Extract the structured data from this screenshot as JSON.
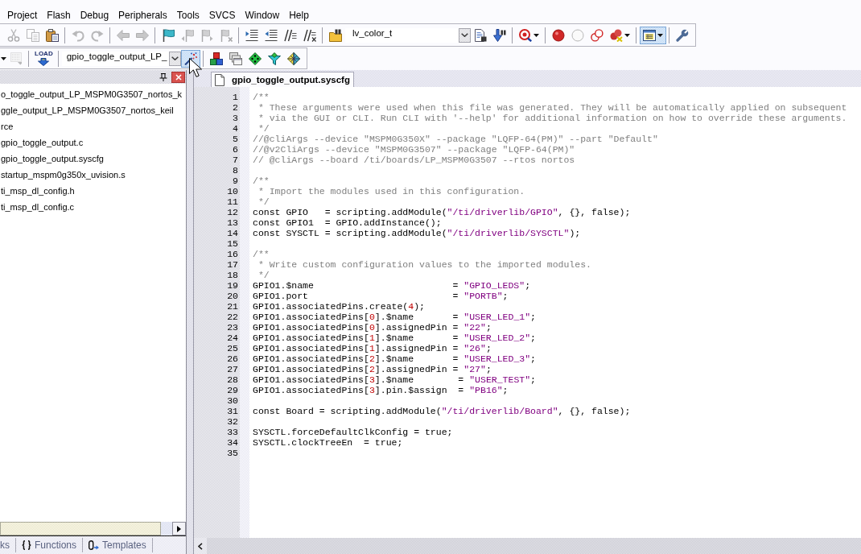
{
  "menu_bar": {
    "items": [
      "Project",
      "Flash",
      "Debug",
      "Peripherals",
      "Tools",
      "SVCS",
      "Window",
      "Help"
    ]
  },
  "toolbars": [
    {
      "groups": [
        {
          "items": [
            {
              "kind": "button",
              "disabled": true,
              "highlighted": false
            },
            {
              "kind": "button",
              "disabled": true,
              "highlighted": false
            },
            {
              "kind": "button",
              "disabled": false,
              "highlighted": false
            }
          ]
        },
        {
          "items": [
            {
              "kind": "button",
              "disabled": true,
              "highlighted": false
            },
            {
              "kind": "button",
              "disabled": true,
              "highlighted": false
            }
          ]
        },
        {
          "items": [
            {
              "kind": "button",
              "disabled": true,
              "highlighted": false
            },
            {
              "kind": "button",
              "disabled": true,
              "highlighted": false
            }
          ]
        },
        {
          "items": [
            {
              "kind": "button",
              "disabled": false,
              "highlighted": false
            },
            {
              "kind": "button",
              "disabled": true,
              "highlighted": false
            },
            {
              "kind": "button",
              "disabled": true,
              "highlighted": false
            },
            {
              "kind": "button",
              "disabled": true,
              "highlighted": false
            }
          ]
        },
        {
          "items": [
            {
              "kind": "button",
              "disabled": false,
              "highlighted": false
            },
            {
              "kind": "button",
              "disabled": false,
              "highlighted": false
            },
            {
              "kind": "button",
              "disabled": false,
              "highlighted": false
            },
            {
              "kind": "button",
              "disabled": false,
              "highlighted": false
            }
          ]
        },
        {
          "items": [
            {
              "kind": "button",
              "disabled": false,
              "highlighted": false
            },
            {
              "kind": "combo",
              "value": "lv_color_t"
            },
            {
              "kind": "button",
              "disabled": false,
              "highlighted": false
            },
            {
              "kind": "button",
              "disabled": false,
              "highlighted": false
            }
          ]
        },
        {
          "items": [
            {
              "kind": "dropdown",
              "disabled": false,
              "highlighted": false
            }
          ]
        },
        {
          "items": [
            {
              "kind": "button",
              "disabled": false,
              "highlighted": false
            },
            {
              "kind": "button",
              "disabled": false,
              "highlighted": false
            },
            {
              "kind": "button",
              "disabled": false,
              "highlighted": false
            },
            {
              "kind": "dropdown",
              "disabled": false,
              "highlighted": false
            }
          ]
        },
        {
          "items": [
            {
              "kind": "dropdown",
              "disabled": false,
              "highlighted": true
            }
          ]
        },
        {
          "items": [
            {
              "kind": "button",
              "disabled": false,
              "highlighted": false
            }
          ]
        }
      ]
    },
    {
      "groups": [
        {
          "items": [
            {
              "kind": "caret"
            },
            {
              "kind": "button",
              "disabled": true,
              "highlighted": false
            }
          ]
        },
        {
          "items": [
            {
              "kind": "button",
              "label": "LOAD",
              "disabled": false,
              "highlighted": false
            }
          ]
        },
        {
          "items": [
            {
              "kind": "combo",
              "value": "gpio_toggle_output_LP_"
            },
            {
              "kind": "button",
              "disabled": false,
              "highlighted": true
            }
          ]
        },
        {
          "items": [
            {
              "kind": "button",
              "disabled": false,
              "highlighted": false
            },
            {
              "kind": "button",
              "disabled": false,
              "highlighted": false
            },
            {
              "kind": "button",
              "disabled": false,
              "highlighted": false
            },
            {
              "kind": "button",
              "disabled": false,
              "highlighted": false
            },
            {
              "kind": "button",
              "disabled": false,
              "highlighted": false
            }
          ]
        }
      ]
    }
  ],
  "project_panel": {
    "items": [
      "o_toggle_output_LP_MSPM0G3507_nortos_k",
      "ggle_output_LP_MSPM0G3507_nortos_keil",
      "rce",
      "gpio_toggle_output.c",
      "gpio_toggle_output.syscfg",
      "startup_mspm0g350x_uvision.s",
      "ti_msp_dl_config.h",
      "ti_msp_dl_config.c"
    ],
    "tabs": [
      {
        "label": "ks",
        "selected": false
      },
      {
        "label": "Functions",
        "selected": false
      },
      {
        "label": "Templates",
        "selected": false
      }
    ]
  },
  "editor": {
    "tabs": [
      {
        "label": "gpio_toggle_output.syscfg",
        "selected": true
      }
    ],
    "lines": [
      {
        "number": "1",
        "tokens": [
          {
            "kind": "comment",
            "text": "/**"
          }
        ]
      },
      {
        "number": "2",
        "tokens": [
          {
            "kind": "comment",
            "text": " * These arguments were used when this file was generated. They will be automatically applied on subsequent"
          }
        ]
      },
      {
        "number": "3",
        "tokens": [
          {
            "kind": "comment",
            "text": " * via the GUI or CLI. Run CLI with '--help' for additional information on how to override these arguments."
          }
        ]
      },
      {
        "number": "4",
        "tokens": [
          {
            "kind": "comment",
            "text": " */"
          }
        ]
      },
      {
        "number": "5",
        "tokens": [
          {
            "kind": "comment",
            "text": "//@cliArgs --device \"MSPM0G350X\" --package \"LQFP-64(PM)\" --part \"Default\""
          }
        ]
      },
      {
        "number": "6",
        "tokens": [
          {
            "kind": "comment",
            "text": "//@v2CliArgs --device \"MSPM0G3507\" --package \"LQFP-64(PM)\""
          }
        ]
      },
      {
        "number": "7",
        "tokens": [
          {
            "kind": "comment",
            "text": "// @cliArgs --board /ti/boards/LP_MSPM0G3507 --rtos nortos"
          }
        ]
      },
      {
        "number": "8"
      },
      {
        "number": "9",
        "tokens": [
          {
            "kind": "comment",
            "text": "/**"
          }
        ]
      },
      {
        "number": "10",
        "tokens": [
          {
            "kind": "comment",
            "text": " * Import the modules used in this configuration."
          }
        ]
      },
      {
        "number": "11",
        "tokens": [
          {
            "kind": "comment",
            "text": " */"
          }
        ]
      },
      {
        "number": "12",
        "tokens": [
          {
            "kind": "text",
            "text": "const GPIO   = scripting.addModule("
          },
          {
            "kind": "string",
            "text": "\"/ti/driverlib/GPIO\""
          },
          {
            "kind": "text",
            "text": ", {}, false);"
          }
        ]
      },
      {
        "number": "13",
        "tokens": [
          {
            "kind": "text",
            "text": "const GPIO1  = GPIO.addInstance();"
          }
        ]
      },
      {
        "number": "14",
        "tokens": [
          {
            "kind": "text",
            "text": "const SYSCTL = scripting.addModule("
          },
          {
            "kind": "string",
            "text": "\"/ti/driverlib/SYSCTL\""
          },
          {
            "kind": "text",
            "text": ");"
          }
        ]
      },
      {
        "number": "15"
      },
      {
        "number": "16",
        "tokens": [
          {
            "kind": "comment",
            "text": "/**"
          }
        ]
      },
      {
        "number": "17",
        "tokens": [
          {
            "kind": "comment",
            "text": " * Write custom configuration values to the imported modules."
          }
        ]
      },
      {
        "number": "18",
        "tokens": [
          {
            "kind": "comment",
            "text": " */"
          }
        ]
      },
      {
        "number": "19",
        "tokens": [
          {
            "kind": "text",
            "text": "GPIO1.$name                         = "
          },
          {
            "kind": "string",
            "text": "\"GPIO_LEDS\""
          },
          {
            "kind": "text",
            "text": ";"
          }
        ]
      },
      {
        "number": "20",
        "tokens": [
          {
            "kind": "text",
            "text": "GPIO1.port                          = "
          },
          {
            "kind": "string",
            "text": "\"PORTB\""
          },
          {
            "kind": "text",
            "text": ";"
          }
        ]
      },
      {
        "number": "21",
        "tokens": [
          {
            "kind": "text",
            "text": "GPIO1.associatedPins.create("
          },
          {
            "kind": "number",
            "text": "4"
          },
          {
            "kind": "text",
            "text": ");"
          }
        ]
      },
      {
        "number": "22",
        "tokens": [
          {
            "kind": "text",
            "text": "GPIO1.associatedPins["
          },
          {
            "kind": "number",
            "text": "0"
          },
          {
            "kind": "text",
            "text": "].$name       = "
          },
          {
            "kind": "string",
            "text": "\"USER_LED_1\""
          },
          {
            "kind": "text",
            "text": ";"
          }
        ]
      },
      {
        "number": "23",
        "tokens": [
          {
            "kind": "text",
            "text": "GPIO1.associatedPins["
          },
          {
            "kind": "number",
            "text": "0"
          },
          {
            "kind": "text",
            "text": "].assignedPin = "
          },
          {
            "kind": "string",
            "text": "\"22\""
          },
          {
            "kind": "text",
            "text": ";"
          }
        ]
      },
      {
        "number": "24",
        "tokens": [
          {
            "kind": "text",
            "text": "GPIO1.associatedPins["
          },
          {
            "kind": "number",
            "text": "1"
          },
          {
            "kind": "text",
            "text": "].$name       = "
          },
          {
            "kind": "string",
            "text": "\"USER_LED_2\""
          },
          {
            "kind": "text",
            "text": ";"
          }
        ]
      },
      {
        "number": "25",
        "tokens": [
          {
            "kind": "text",
            "text": "GPIO1.associatedPins["
          },
          {
            "kind": "number",
            "text": "1"
          },
          {
            "kind": "text",
            "text": "].assignedPin = "
          },
          {
            "kind": "string",
            "text": "\"26\""
          },
          {
            "kind": "text",
            "text": ";"
          }
        ]
      },
      {
        "number": "26",
        "tokens": [
          {
            "kind": "text",
            "text": "GPIO1.associatedPins["
          },
          {
            "kind": "number",
            "text": "2"
          },
          {
            "kind": "text",
            "text": "].$name       = "
          },
          {
            "kind": "string",
            "text": "\"USER_LED_3\""
          },
          {
            "kind": "text",
            "text": ";"
          }
        ]
      },
      {
        "number": "27",
        "tokens": [
          {
            "kind": "text",
            "text": "GPIO1.associatedPins["
          },
          {
            "kind": "number",
            "text": "2"
          },
          {
            "kind": "text",
            "text": "].assignedPin = "
          },
          {
            "kind": "string",
            "text": "\"27\""
          },
          {
            "kind": "text",
            "text": ";"
          }
        ]
      },
      {
        "number": "28",
        "tokens": [
          {
            "kind": "text",
            "text": "GPIO1.associatedPins["
          },
          {
            "kind": "number",
            "text": "3"
          },
          {
            "kind": "text",
            "text": "].$name        = "
          },
          {
            "kind": "string",
            "text": "\"USER_TEST\""
          },
          {
            "kind": "text",
            "text": ";"
          }
        ]
      },
      {
        "number": "29",
        "tokens": [
          {
            "kind": "text",
            "text": "GPIO1.associatedPins["
          },
          {
            "kind": "number",
            "text": "3"
          },
          {
            "kind": "text",
            "text": "].pin.$assign  = "
          },
          {
            "kind": "string",
            "text": "\"PB16\""
          },
          {
            "kind": "text",
            "text": ";"
          }
        ]
      },
      {
        "number": "30"
      },
      {
        "number": "31",
        "tokens": [
          {
            "kind": "text",
            "text": "const Board = scripting.addModule("
          },
          {
            "kind": "string",
            "text": "\"/ti/driverlib/Board\""
          },
          {
            "kind": "text",
            "text": ", {}, false);"
          }
        ]
      },
      {
        "number": "32"
      },
      {
        "number": "33",
        "tokens": [
          {
            "kind": "text",
            "text": "SYSCTL.forceDefaultClkConfig = true;"
          }
        ]
      },
      {
        "number": "34",
        "tokens": [
          {
            "kind": "text",
            "text": "SYSCTL.clockTreeEn  = true;"
          }
        ]
      },
      {
        "number": "35"
      }
    ]
  }
}
